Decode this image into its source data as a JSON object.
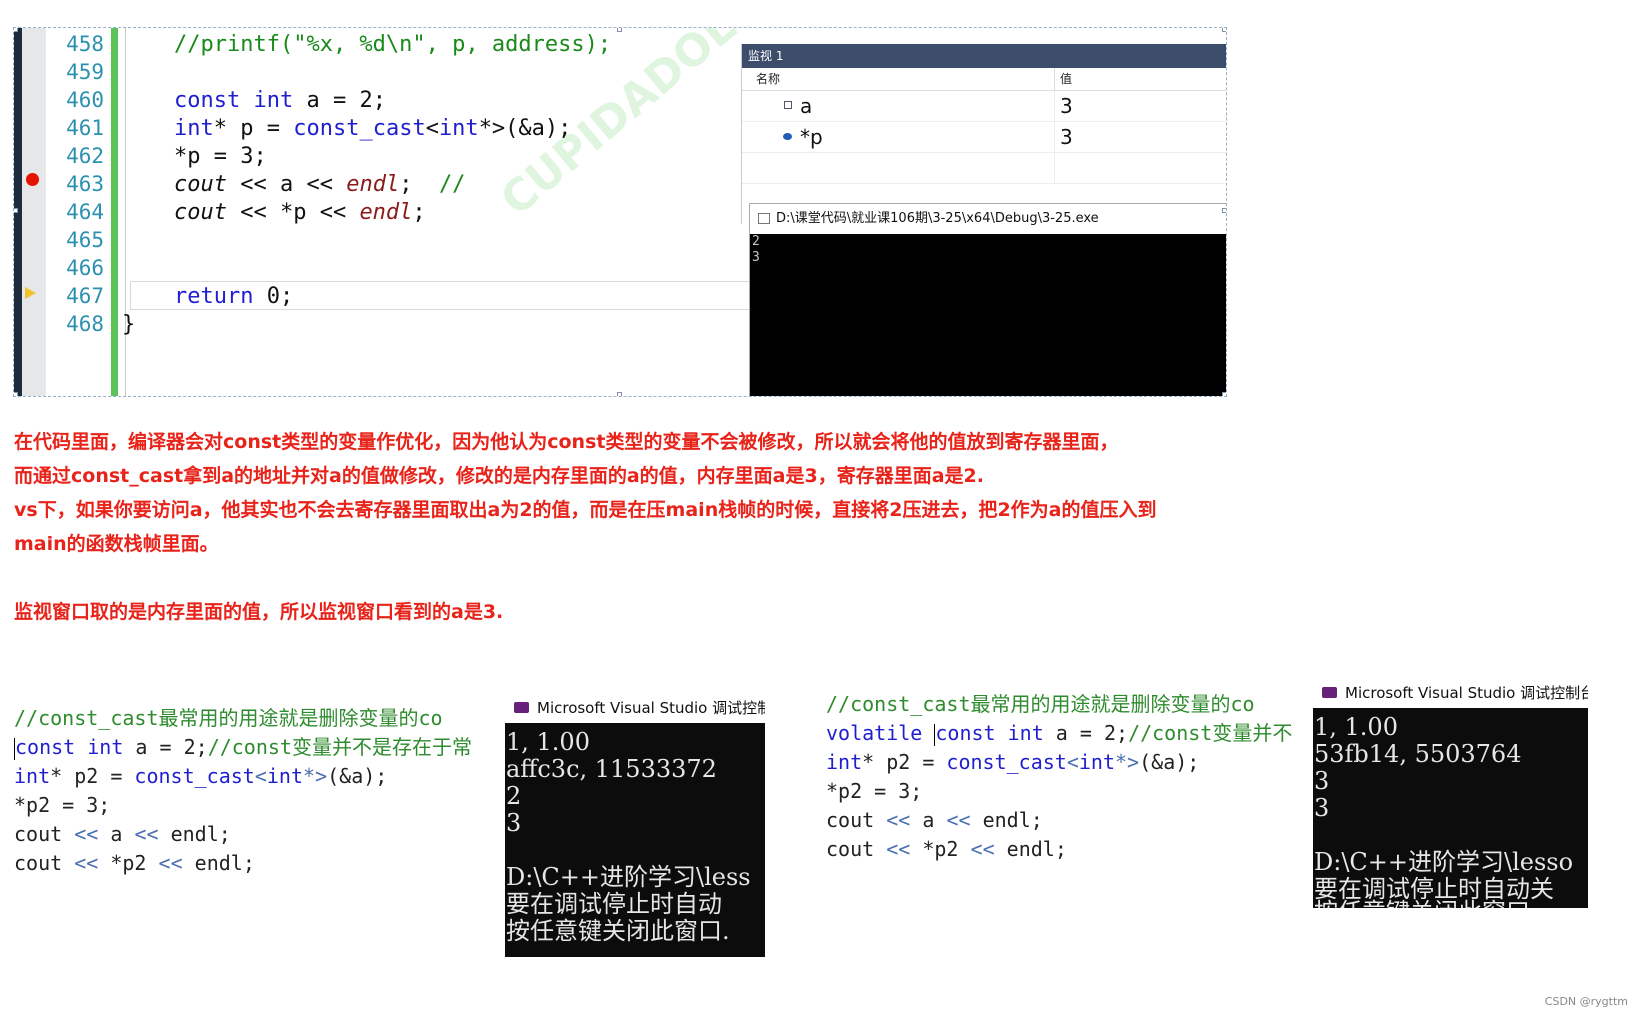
{
  "editor": {
    "lines": [
      {
        "num": "458",
        "code": "//printf(\"%x, %d\\n\", p, address);"
      },
      {
        "num": "459",
        "code": ""
      },
      {
        "num": "460",
        "code": "const int a = 2;"
      },
      {
        "num": "461",
        "code": "int* p = const_cast<int*>(&a);"
      },
      {
        "num": "462",
        "code": "*p = 3;"
      },
      {
        "num": "463",
        "code": "cout << a << endl;  //"
      },
      {
        "num": "464",
        "code": "cout << *p << endl;"
      },
      {
        "num": "465",
        "code": ""
      },
      {
        "num": "466",
        "code": ""
      },
      {
        "num": "467",
        "code": "return 0;"
      },
      {
        "num": "468",
        "code": "}"
      }
    ],
    "watermark": "CUPIDADOL"
  },
  "watch": {
    "title": "监视 1",
    "col_name": "名称",
    "col_value": "值",
    "rows": [
      {
        "name": "a",
        "value": "3"
      },
      {
        "name": "*p",
        "value": "3"
      }
    ]
  },
  "console_top": {
    "title": "D:\\课堂代码\\就业课106期\\3-25\\x64\\Debug\\3-25.exe",
    "lines": [
      "2",
      "3"
    ]
  },
  "notes": {
    "line1": "在代码里面，编译器会对const类型的变量作优化，因为他认为const类型的变量不会被修改，所以就会将他的值放到寄存器里面，",
    "line2": "而通过const_cast拿到a的地址并对a的值做修改，修改的是内存里面的a的值，内存里面a是3，寄存器里面a是2.",
    "line3": "vs下，如果你要访问a，他其实也不会去寄存器里面取出a为2的值，而是在压main栈帧的时候，直接将2压进去，把2作为a的值压入到",
    "line4": "main的函数栈帧里面。",
    "line5": "监视窗口取的是内存里面的值，所以监视窗口看到的a是3."
  },
  "bottom_left": {
    "comment": "//const_cast最常用的用途就是删除变量的co",
    "l1_kw1": "const",
    "l1_kw2": "int",
    "l1_rest": " a = 2;",
    "l1_cm": "//const变量并不是存在于常",
    "l2_type": "int",
    "l2_mid": "* p2 = ",
    "l2_cast": "const_cast",
    "l2_tpl_open": "<",
    "l2_tpl_kw": "int",
    "l2_tpl_close": "*>",
    "l2_end": "(&a);",
    "l3": "*p2 = 3;",
    "l4_a": "cout ",
    "l4_op1": "<<",
    "l4_b": " a ",
    "l4_op2": "<<",
    "l4_c": " endl;",
    "l5_a": "cout ",
    "l5_op1": "<<",
    "l5_b": " *p2 ",
    "l5_op2": "<<",
    "l5_c": " endl;"
  },
  "console_left": {
    "title": "Microsoft Visual Studio 调试控制",
    "lines": [
      "1, 1.00",
      "affc3c, 11533372",
      "2",
      "3",
      "",
      "D:\\C++进阶学习\\less",
      "要在调试停止时自动",
      "按任意键关闭此窗口."
    ]
  },
  "bottom_right": {
    "comment": "//const_cast最常用的用途就是删除变量的co",
    "l1_kw0": "volatile",
    "l1_kw1": "const",
    "l1_kw2": "int",
    "l1_rest": " a = 2;",
    "l1_cm": "//const变量并不",
    "l2_type": "int",
    "l2_mid": "* p2 = ",
    "l2_cast": "const_cast",
    "l2_tpl_open": "<",
    "l2_tpl_kw": "int",
    "l2_tpl_close": "*>",
    "l2_end": "(&a);",
    "l3": "*p2 = 3;",
    "l4_a": "cout ",
    "l4_op1": "<<",
    "l4_b": " a ",
    "l4_op2": "<<",
    "l4_c": " endl;",
    "l5_a": "cout ",
    "l5_op1": "<<",
    "l5_b": " *p2 ",
    "l5_op2": "<<",
    "l5_c": " endl;"
  },
  "console_right": {
    "title": "Microsoft Visual Studio 调试控制台",
    "lines": [
      "1, 1.00",
      "53fb14, 5503764",
      "3",
      "3",
      "",
      "D:\\C++进阶学习\\lesso",
      "要在调试停止时自动关",
      "按任意键关闭此窗口"
    ]
  },
  "credit": "CSDN @rygttm"
}
